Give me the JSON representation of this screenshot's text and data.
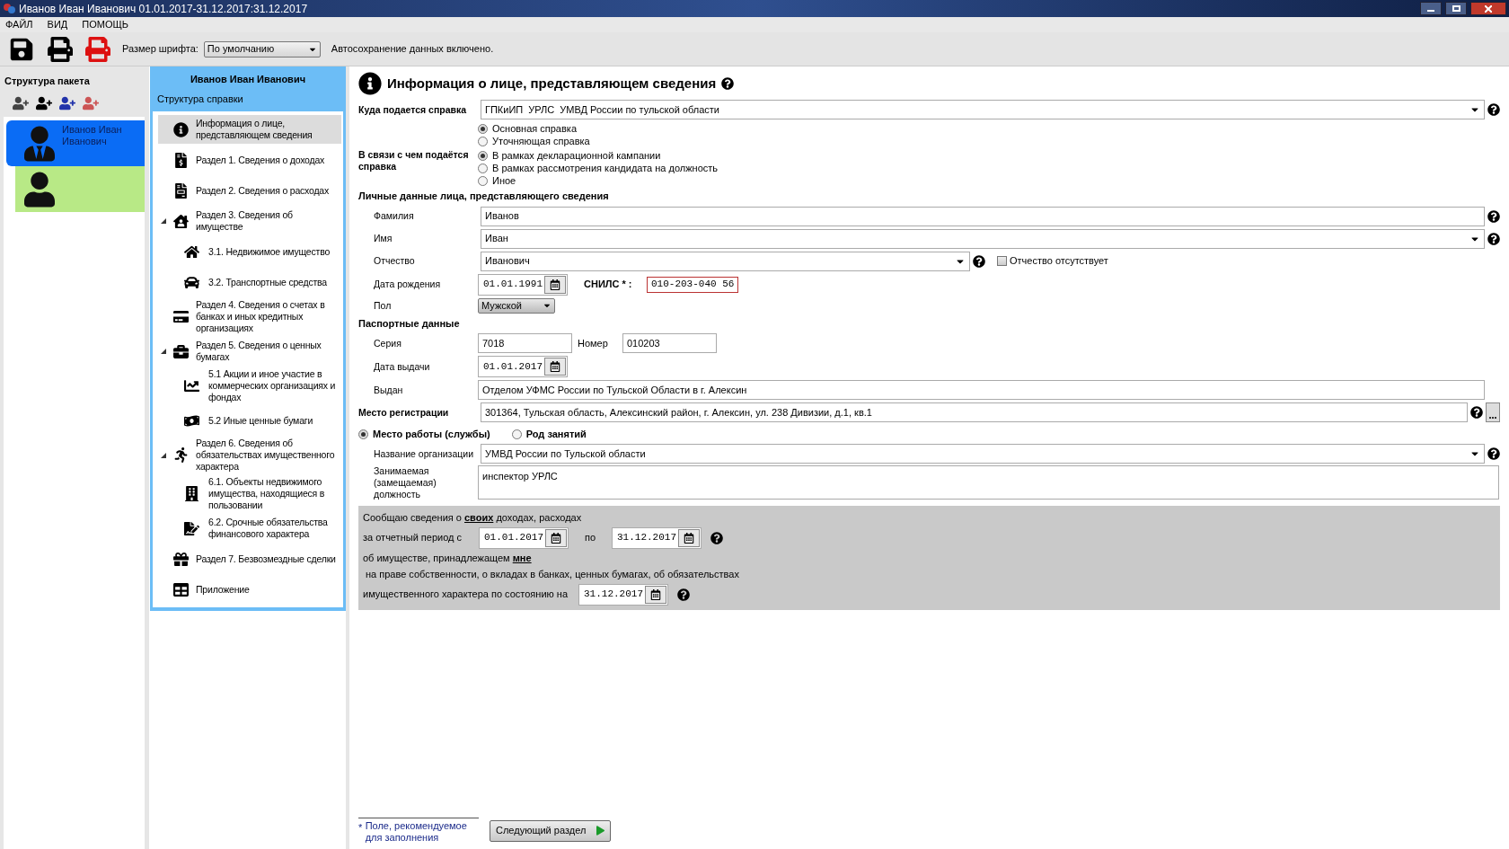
{
  "window": {
    "title": "Иванов Иван Иванович 01.01.2017-31.12.2017:31.12.2017"
  },
  "menu": [
    "ФАЙЛ",
    "ВИД",
    "ПОМОЩЬ"
  ],
  "toolbar": {
    "font_size_label": "Размер шрифта:",
    "font_size_value": "По умолчанию",
    "autosave_text": "Автосохранение данных включено."
  },
  "package": {
    "title": "Структура пакета",
    "persons": [
      {
        "kind": "suit",
        "name": "Иванов Иван Иванович",
        "color": "#0a6cf5",
        "selected": true
      },
      {
        "kind": "helmet",
        "color": "#b8e986",
        "selected": false
      }
    ]
  },
  "nav": {
    "person": "Иванов Иван Иванович",
    "subtitle": "Структура справки",
    "items": [
      {
        "label": "Информация о лице, представляющем сведения",
        "selected": true
      },
      {
        "label": "Раздел 1. Сведения о доходах",
        "selected": false
      },
      {
        "label": "Раздел 2. Сведения о расходах",
        "selected": false
      },
      {
        "label": "Раздел 3. Сведения об имуществе",
        "selected": false,
        "expanded": true,
        "children": [
          {
            "label": "3.1. Недвижимое имущество",
            "selected": false
          },
          {
            "label": "3.2. Транспортные средства",
            "selected": false
          }
        ]
      },
      {
        "label": "Раздел 4. Сведения о счетах в банках и иных кредитных организациях",
        "selected": false
      },
      {
        "label": "Раздел 5. Сведения о ценных бумагах",
        "selected": false,
        "expanded": true,
        "children": [
          {
            "label": "5.1 Акции и иное участие в коммерческих организациях и фондах",
            "selected": false
          },
          {
            "label": "5.2 Иные ценные бумаги",
            "selected": false
          }
        ]
      },
      {
        "label": "Раздел 6. Сведения об обязательствах имущественного характера",
        "selected": false,
        "expanded": true,
        "children": [
          {
            "label": "6.1. Объекты недвижимого имущества, находящиеся в пользовании",
            "selected": false
          },
          {
            "label": "6.2. Срочные обязательства финансового характера",
            "selected": false
          }
        ]
      },
      {
        "label": "Раздел 7. Безвозмездные сделки",
        "selected": false
      },
      {
        "label": "Приложение",
        "selected": false
      }
    ]
  },
  "form": {
    "title": "Информация о лице, представляющем сведения",
    "destination": {
      "label": "Куда подается справка",
      "value": "ГПКиИП  УРЛС  УМВД России по тульской области"
    },
    "report_type": [
      {
        "label": "Основная справка",
        "selected": true
      },
      {
        "label": "Уточняющая справка",
        "selected": false
      }
    ],
    "reason": {
      "label": "В связи с чем подаётся справка",
      "options": [
        {
          "label": "В рамках декларационной кампании",
          "selected": true
        },
        {
          "label": "В рамках рассмотрения кандидата на должность",
          "selected": false
        },
        {
          "label": "Иное",
          "selected": false
        }
      ]
    },
    "personal": {
      "heading": "Личные данные лица, представляющего сведения",
      "surname": {
        "label": "Фамилия",
        "value": "Иванов"
      },
      "name": {
        "label": "Имя",
        "value": "Иван"
      },
      "patronymic": {
        "label": "Отчество",
        "value": "Иванович"
      },
      "no_patronymic": {
        "label": "Отчество отсутствует",
        "checked": false
      },
      "birth_date": {
        "label": "Дата рождения",
        "value": "01.01.1991"
      },
      "snils": {
        "label": "СНИЛС * :",
        "value": "010-203-040 56"
      },
      "gender": {
        "label": "Пол",
        "value": "Мужской"
      }
    },
    "passport": {
      "heading": "Паспортные данные",
      "series": {
        "label": "Серия",
        "value": "7018"
      },
      "number": {
        "label": "Номер",
        "value": "010203"
      },
      "issue_date": {
        "label": "Дата выдачи",
        "value": "01.01.2017"
      },
      "issued_by": {
        "label": "Выдан",
        "value": "Отделом УФМС России по Тульской Области в г. Алексин"
      }
    },
    "registration": {
      "label": "Место регистрации",
      "value": "301364, Тульская область, Алексинский район, г. Алексин, ул. 238 Дивизии, д.1, кв.1"
    },
    "work_mode": [
      {
        "label": "Место работы (службы)",
        "selected": true
      },
      {
        "label": "Род занятий",
        "selected": false
      }
    ],
    "organization": {
      "label": "Название организации",
      "value": "УМВД России по Тульской области"
    },
    "position": {
      "label": "Занимаемая (замещаемая) должность",
      "value": "инспектор УРЛС"
    },
    "period": {
      "line1": "Сообщаю сведения о **своих** доходах, расходах",
      "from_label": "за отчетный период с",
      "from": "01.01.2017",
      "to_label": "по",
      "to": "31.12.2017",
      "line2": "об имуществе, принадлежащем **мне**",
      "line3": "на праве собственности, о вкладах в банках, ценных бумагах, об обязательствах",
      "asof_label": "имущественного характера по состоянию на",
      "asof": "31.12.2017"
    },
    "footnote": {
      "mark": "*",
      "text": "Поле, рекомендуемое для заполнения"
    },
    "next_button": "Следующий раздел"
  }
}
